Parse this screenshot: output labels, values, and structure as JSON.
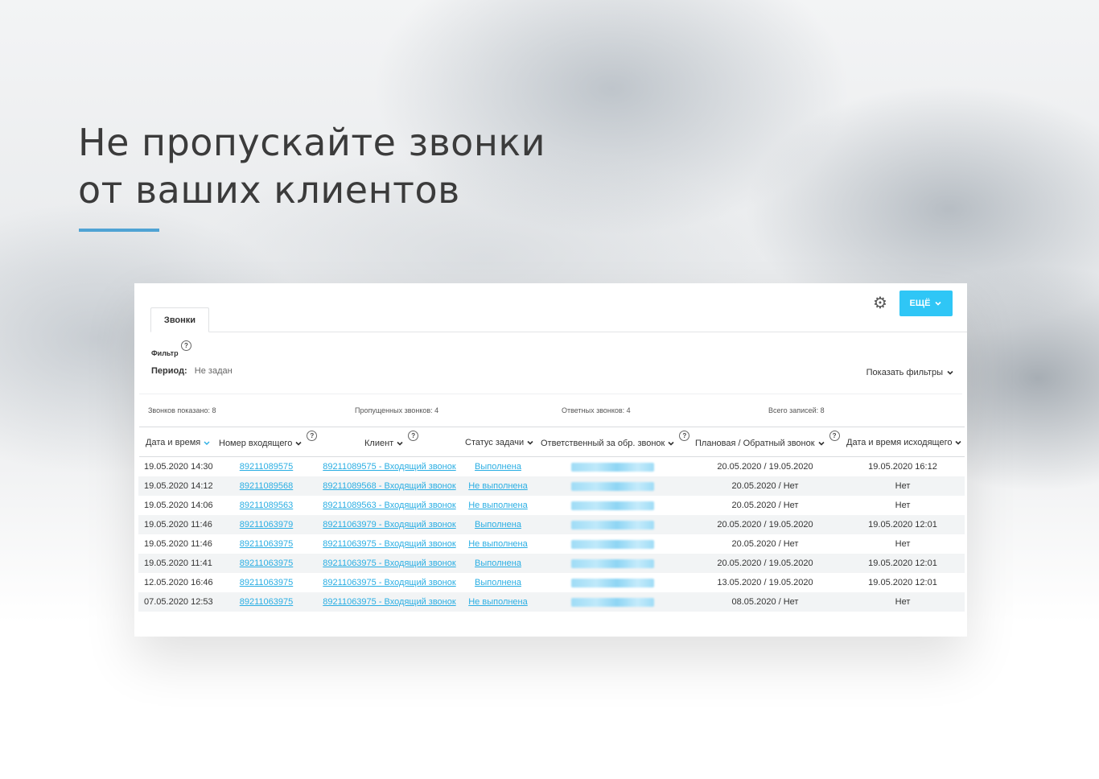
{
  "headline": {
    "line1": "Не пропускайте звонки",
    "line2": "от ваших клиентов"
  },
  "colors": {
    "accent": "#4fa3d4",
    "button": "#2fc6f6",
    "link": "#2aaee3"
  },
  "toolbar": {
    "gear_icon": "gear-icon",
    "more_label": "ЕЩЁ"
  },
  "tabs": [
    {
      "label": "Звонки",
      "active": true
    }
  ],
  "filter": {
    "label": "Фильтр",
    "help": "?",
    "period_label": "Период:",
    "period_value": "Не задан",
    "show_filters": "Показать фильтры"
  },
  "stats": {
    "shown": "Звонков показано: 8",
    "missed": "Пропущенных звонков: 4",
    "callbacks": "Ответных звонков: 4",
    "total": "Всего записей: 8"
  },
  "table": {
    "columns": [
      "Дата и время",
      "Номер входящего",
      "Клиент",
      "Статус задачи",
      "Ответственный за обр. звонок",
      "Плановая / Обратный звонок",
      "Дата и время исходящего"
    ],
    "rows": [
      {
        "datetime": "19.05.2020 14:30",
        "number": "89211089575",
        "client": "89211089575 - Входящий звонок",
        "status": "Выполнена",
        "planned": "20.05.2020 / 19.05.2020",
        "outgoing": "19.05.2020 16:12"
      },
      {
        "datetime": "19.05.2020 14:12",
        "number": "89211089568",
        "client": "89211089568 - Входящий звонок",
        "status": "Не выполнена",
        "planned": "20.05.2020 / Нет",
        "outgoing": "Нет"
      },
      {
        "datetime": "19.05.2020 14:06",
        "number": "89211089563",
        "client": "89211089563 - Входящий звонок",
        "status": "Не выполнена",
        "planned": "20.05.2020 / Нет",
        "outgoing": "Нет"
      },
      {
        "datetime": "19.05.2020 11:46",
        "number": "89211063979",
        "client": "89211063979 - Входящий звонок",
        "status": "Выполнена",
        "planned": "20.05.2020 / 19.05.2020",
        "outgoing": "19.05.2020 12:01"
      },
      {
        "datetime": "19.05.2020 11:46",
        "number": "89211063975",
        "client": "89211063975 - Входящий звонок",
        "status": "Не выполнена",
        "planned": "20.05.2020 / Нет",
        "outgoing": "Нет"
      },
      {
        "datetime": "19.05.2020 11:41",
        "number": "89211063975",
        "client": "89211063975 - Входящий звонок",
        "status": "Выполнена",
        "planned": "20.05.2020 / 19.05.2020",
        "outgoing": "19.05.2020 12:01"
      },
      {
        "datetime": "12.05.2020 16:46",
        "number": "89211063975",
        "client": "89211063975 - Входящий звонок",
        "status": "Выполнена",
        "planned": "13.05.2020 / 19.05.2020",
        "outgoing": "19.05.2020 12:01"
      },
      {
        "datetime": "07.05.2020 12:53",
        "number": "89211063975",
        "client": "89211063975 - Входящий звонок",
        "status": "Не выполнена",
        "planned": "08.05.2020 / Нет",
        "outgoing": "Нет"
      }
    ]
  }
}
